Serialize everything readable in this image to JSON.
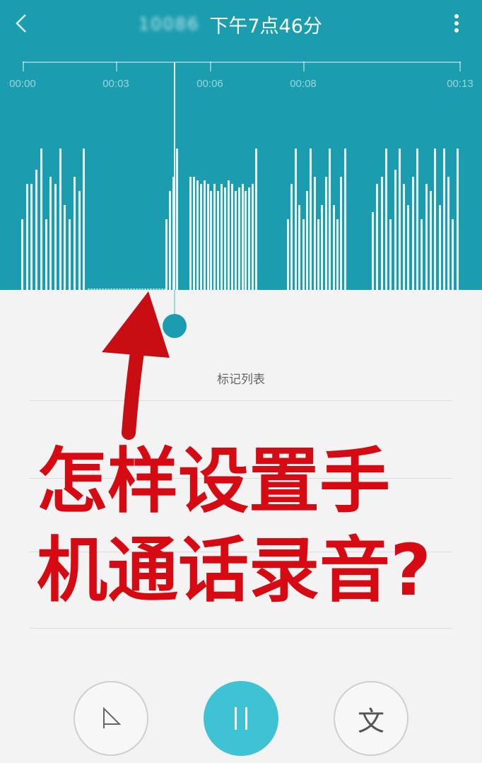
{
  "header": {
    "caller": "10086",
    "call_time": "下午7点46分",
    "back_icon": "chevron-left-icon",
    "menu_icon": "more-vertical-icon"
  },
  "timeline": {
    "ticks": [
      "00:00",
      "00:03",
      "00:06",
      "00:08",
      "00:13"
    ]
  },
  "marks": {
    "title": "标记列表"
  },
  "caption": {
    "line1": "怎样设置手",
    "line2": "机通话录音?"
  },
  "controls": {
    "mark_icon": "flag-icon",
    "pause_icon": "pause-icon",
    "transcribe_label": "文"
  },
  "colors": {
    "header_bg": "#1b9daf",
    "accent": "#3fc2d3",
    "caption_red": "#d60a12"
  },
  "playback": {
    "current_fraction": 0.35
  }
}
